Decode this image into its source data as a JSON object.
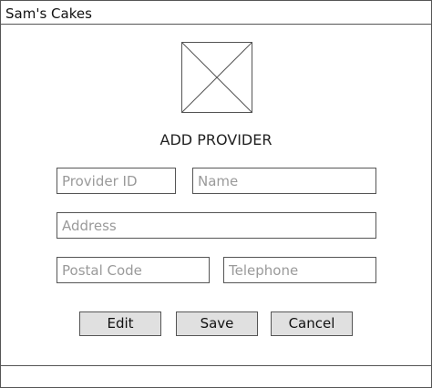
{
  "window": {
    "title": "Sam's Cakes"
  },
  "form": {
    "heading": "ADD PROVIDER",
    "image_icon": "image-placeholder-icon",
    "fields": {
      "provider_id": {
        "placeholder": "Provider ID",
        "value": ""
      },
      "name": {
        "placeholder": "Name",
        "value": ""
      },
      "address": {
        "placeholder": "Address",
        "value": ""
      },
      "postal_code": {
        "placeholder": "Postal Code",
        "value": ""
      },
      "telephone": {
        "placeholder": "Telephone",
        "value": ""
      }
    },
    "buttons": {
      "edit": "Edit",
      "save": "Save",
      "cancel": "Cancel"
    }
  },
  "colors": {
    "border": "#555555",
    "button_background": "#e0e0e0",
    "placeholder_text": "#9a9a9a"
  }
}
